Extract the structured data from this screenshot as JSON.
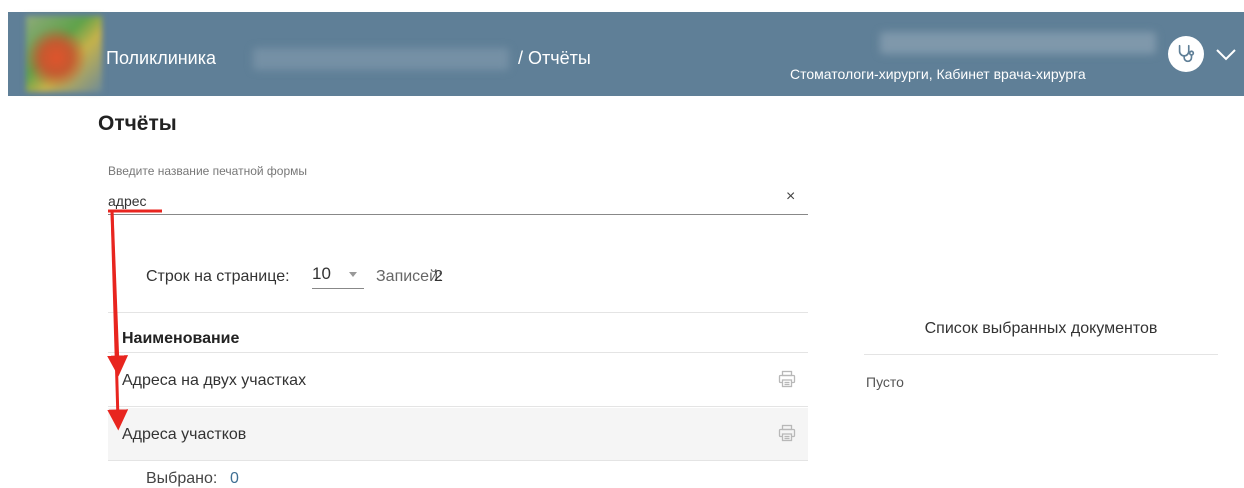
{
  "header": {
    "clinic_label": "Поликлиника",
    "breadcrumb": "/ Отчёты",
    "department": "Стоматологи-хирурги, Кабинет врача-хирурга",
    "user_icon": "stethoscope-icon",
    "menu_icon": "chevron-down-icon",
    "bg_color": "#5f7f97"
  },
  "page": {
    "title": "Отчёты"
  },
  "search": {
    "label": "Введите название печатной формы",
    "value": "адрес",
    "clear_glyph": "×"
  },
  "pagination": {
    "rows_label": "Строк на странице:",
    "rows_value": "10",
    "records_label": "Записей:",
    "records_value": "2"
  },
  "table": {
    "column_header": "Наименование",
    "rows": [
      {
        "label": "Адреса на двух участках",
        "action_icon": "printer-icon"
      },
      {
        "label": "Адреса участков",
        "action_icon": "printer-icon"
      }
    ]
  },
  "selection": {
    "label": "Выбрано:",
    "value": "0",
    "value_color": "#3f6f93"
  },
  "selected_list": {
    "title": "Список выбранных документов",
    "empty_text": "Пусто"
  },
  "annotation": {
    "arrow_color": "#e8251f"
  }
}
